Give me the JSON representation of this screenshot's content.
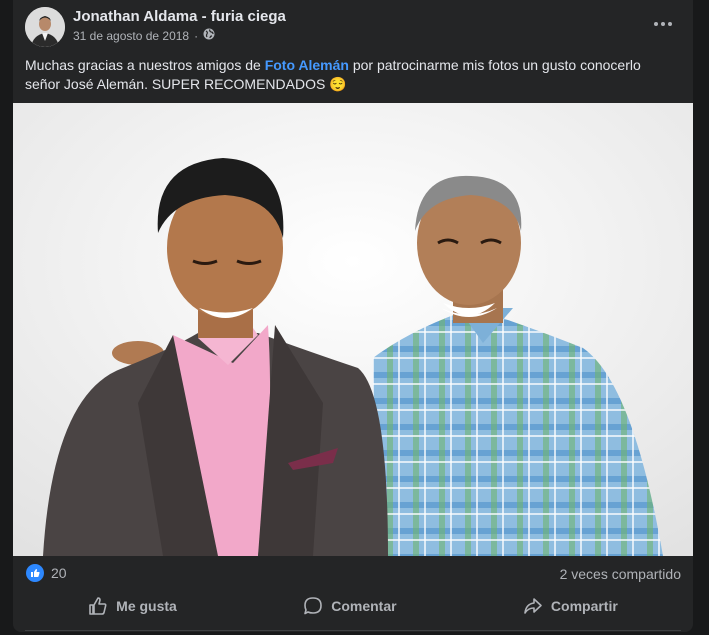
{
  "post": {
    "author": "Jonathan Aldama - furia ciega",
    "date": "31 de agosto de 2018",
    "privacy_icon": "globe-icon",
    "text_before": "Muchas gracias a nuestros amigos de ",
    "mention": "Foto Alemán",
    "text_after": " por patrocinarme mis fotos  un gusto conocerlo señor José Alemán. SUPER RECOMENDADOS ",
    "emoji": "😌"
  },
  "stats": {
    "reaction_icon": "like-icon",
    "likes": "20",
    "shares": "2 veces compartido"
  },
  "actions": {
    "like": "Me gusta",
    "comment": "Comentar",
    "share": "Compartir"
  },
  "colors": {
    "background": "#18191a",
    "card": "#242526",
    "link": "#4599ff",
    "like_blue": "#2d88ff"
  }
}
